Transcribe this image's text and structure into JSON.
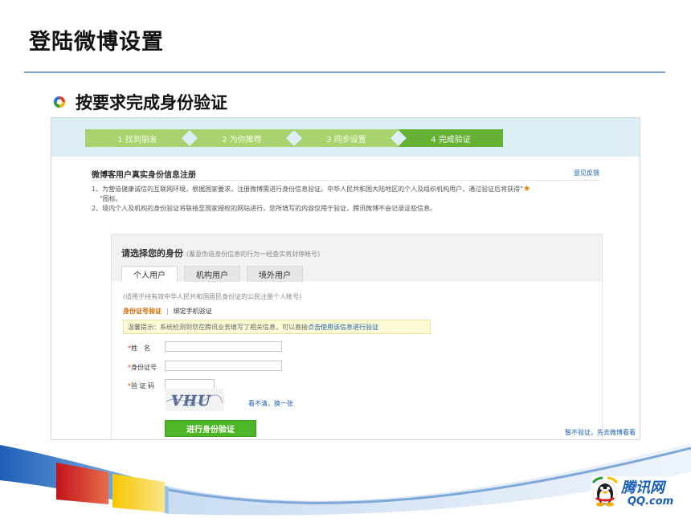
{
  "slide": {
    "title": "登陆微博设置",
    "bullet": "按要求完成身份验证"
  },
  "steps": [
    {
      "label": "1 找到朋友"
    },
    {
      "label": "2 为你推荐"
    },
    {
      "label": "3 同步设置"
    },
    {
      "label": "4 完成验证"
    }
  ],
  "form": {
    "section_title": "微博客用户真实身份信息注册",
    "feedback": "意见反馈",
    "note1": "1、为营造健康诚信的互联网环境，根据国家要求，注册微博需进行身份信息验证。中华人民共和国大陆地区的个人及组织机构用户，通过验证后将获得\"",
    "note1_tail": "\"图标。",
    "note2": "2、境内个人及机构的身份验证将联接至国家授权的网站进行，您所填写的内容仅用于验证，腾讯微博不会记录这些信息。",
    "panel_title": "请选择您的身份",
    "panel_title_note": "(蓄意伪造身份信息的行为一经查实将封停帐号)",
    "tabs": [
      "个人用户",
      "机构用户",
      "境外用户"
    ],
    "applies": "(适用于持有效中华人民共和国居民身份证的公民注册个人帐号)",
    "subtab_id": "身份证号验证",
    "subtab_sep": "|",
    "subtab_phone": "绑定手机验证",
    "tip_text": "温馨提示：系统检测到您在腾讯业务填写了相关信息，可以直接",
    "tip_link": "点击使用该信息进行验证",
    "name_label": "姓　名",
    "id_label": "身份证号",
    "captcha_label": "验 证 码",
    "required_mark": "*",
    "captcha_text": "VHU",
    "refresh": "看不清，换一张",
    "submit": "进行身份验证",
    "skip": "暂不验证，先去微博看看"
  },
  "logo": {
    "main": "腾讯网",
    "sub": "QQ.com"
  },
  "colors": {
    "step_green": "#a8d36f",
    "step_active": "#63b233",
    "link_blue": "#1b5fae"
  }
}
